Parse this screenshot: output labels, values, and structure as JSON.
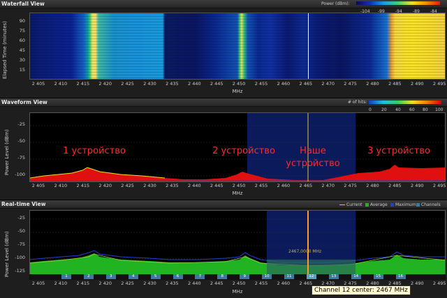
{
  "waterfall": {
    "title": "Waterfall View",
    "legend_label": "Power (dBm):",
    "legend_ticks": [
      "-104",
      "-99",
      "-94",
      "-89",
      "-84"
    ],
    "ylabel": "Elapsed Time (minutes)",
    "yticks": [
      "90",
      "75",
      "60",
      "45",
      "30",
      "15"
    ],
    "xlabel": "MHz"
  },
  "waveform": {
    "title": "Waveform View",
    "legend_label": "# of hits:",
    "legend_ticks": [
      "0",
      "20",
      "40",
      "60",
      "80",
      "100"
    ],
    "ylabel": "Power Level (dBm)",
    "yticks": [
      "-25",
      "-50",
      "-75",
      "-100"
    ],
    "xlabel": "MHz",
    "annotations": {
      "dev1": "1 устройство",
      "dev2": "2 устройство",
      "ours_line1": "Наше",
      "ours_line2": "устройство",
      "dev3": "3 устройство"
    }
  },
  "realtime": {
    "title": "Real-time View",
    "legend": {
      "current": "Current",
      "average": "Average",
      "maximum": "Maximum",
      "channels": "Channels"
    },
    "ylabel": "Power Level (dBm)",
    "yticks": [
      "-25",
      "-50",
      "-75",
      "-100",
      "-125"
    ],
    "xlabel": "MHz",
    "marker_label": "2467,0000 MHz",
    "channels": [
      "1",
      "2",
      "3",
      "4",
      "5",
      "6",
      "7",
      "8",
      "9",
      "10",
      "11",
      "12",
      "13",
      "14",
      "15",
      "16"
    ],
    "tooltip": "Channel 12 center: 2467 MHz"
  },
  "xticks": [
    "2 405",
    "2 410",
    "2 415",
    "2 420",
    "2 425",
    "2 430",
    "2 435",
    "2 440",
    "2 445",
    "2 450",
    "2 455",
    "2 460",
    "2 465",
    "2 470",
    "2 475",
    "2 480",
    "2 485",
    "2 490",
    "2 495"
  ],
  "colors": {
    "accent_marker": "#ff9a2a",
    "annotation": "#ff2a2a",
    "average_fill": "#22b322",
    "selection": "#0a1a5a"
  }
}
